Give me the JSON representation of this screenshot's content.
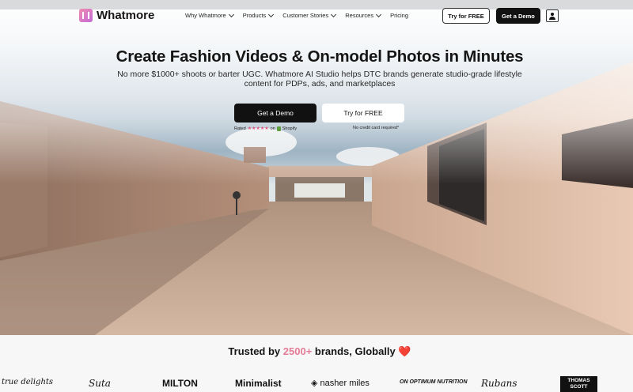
{
  "nav": {
    "brand": "Whatmore",
    "menu": [
      {
        "label": "Why Whatmore",
        "has_dropdown": true
      },
      {
        "label": "Products",
        "has_dropdown": true
      },
      {
        "label": "Customer Stories",
        "has_dropdown": true
      },
      {
        "label": "Resources",
        "has_dropdown": true
      },
      {
        "label": "Pricing",
        "has_dropdown": false
      }
    ],
    "try_label": "Try for FREE",
    "demo_label": "Get a Demo"
  },
  "hero": {
    "title": "Create Fashion Videos & On-model Photos in Minutes",
    "subtitle": "No more $1000+ shoots or barter UGC. Whatmore AI Studio helps DTC brands generate studio-grade lifestyle content for PDPs, ads, and marketplaces",
    "demo_label": "Get a Demo",
    "try_label": "Try for FREE",
    "rated_prefix": "Rated",
    "stars": "★★★★★",
    "rated_on": "on",
    "rated_platform": "Shopify",
    "no_card": "No credit card required*"
  },
  "trusted": {
    "prefix": "Trusted by",
    "count": "2500+",
    "suffix": "brands, Globally",
    "heart": "❤️"
  },
  "brands": [
    "true delights",
    "Suta",
    "MILTON",
    "Minimalist",
    "nasher miles",
    "ON OPTIMUM NUTRITION",
    "Rubans",
    "THOMAS SCOTT"
  ],
  "colors": {
    "accent": "#e57b97",
    "button_dark": "#111111",
    "heart": "#e0303a"
  }
}
